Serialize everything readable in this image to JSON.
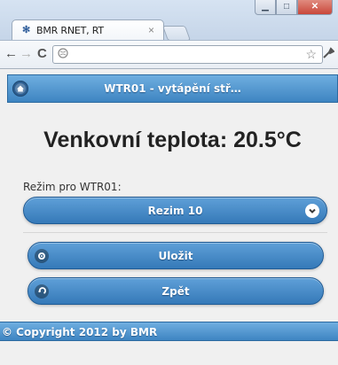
{
  "browser": {
    "tab_title": "BMR RNET, RT",
    "tab_close": "×",
    "window_controls": {
      "minimize": "▁",
      "maximize": "□",
      "close": "✕"
    },
    "nav": {
      "back": "←",
      "forward": "→",
      "reload": "C"
    },
    "address_icon": "globe-icon",
    "star": "☆",
    "wrench": "🔧"
  },
  "page": {
    "header_title": "WTR01 - vytápění stř…",
    "temperature_text": "Venkovní teplota: 20.5°C",
    "mode_label": "Režim pro WTR01:",
    "mode_select": {
      "value": "Rezim 10"
    },
    "buttons": {
      "save": "Uložit",
      "back": "Zpět"
    },
    "footer": "© Copyright 2012 by BMR"
  },
  "colors": {
    "accent": "#3e85c2",
    "header_gradient_top": "#6faee0",
    "button_gradient_top": "#5fa0d8",
    "button_gradient_bottom": "#3579b8",
    "page_bg": "#f0f0f0"
  }
}
